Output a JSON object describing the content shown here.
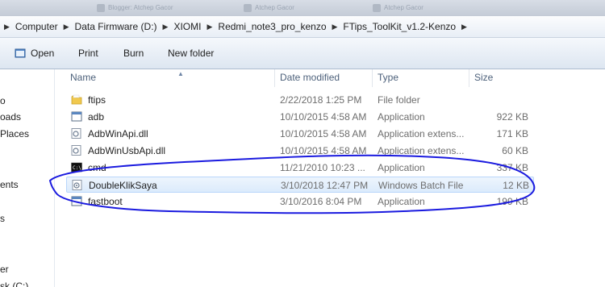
{
  "address_bar": {
    "breadcrumbs": [
      "Computer",
      "Data Firmware (D:)",
      "XIOMI",
      "Redmi_note3_pro_kenzo",
      "FTips_ToolKit_v1.2-Kenzo"
    ]
  },
  "background_tabs": [
    "Blogger: Atchep Gacor",
    "Atchep Gacor",
    "Atchep Gacor"
  ],
  "toolbar": {
    "open_label": "Open",
    "print_label": "Print",
    "burn_label": "Burn",
    "new_folder_label": "New folder"
  },
  "nav_pane": {
    "items": [
      "o",
      "oads",
      "Places",
      "ents",
      "s",
      "er",
      "sk (C:)"
    ]
  },
  "columns": {
    "name": "Name",
    "date_modified": "Date modified",
    "type": "Type",
    "size": "Size"
  },
  "files": [
    {
      "name": "ftips",
      "date": "2/22/2018 1:25 PM",
      "type": "File folder",
      "size": "",
      "icon": "folder-icon"
    },
    {
      "name": "adb",
      "date": "10/10/2015 4:58 AM",
      "type": "Application",
      "size": "922 KB",
      "icon": "application-icon"
    },
    {
      "name": "AdbWinApi.dll",
      "date": "10/10/2015 4:58 AM",
      "type": "Application extens...",
      "size": "171 KB",
      "icon": "dll-icon"
    },
    {
      "name": "AdbWinUsbApi.dll",
      "date": "10/10/2015 4:58 AM",
      "type": "Application extens...",
      "size": "60 KB",
      "icon": "dll-icon"
    },
    {
      "name": "cmd",
      "date": "11/21/2010 10:23 ...",
      "type": "Application",
      "size": "337 KB",
      "icon": "cmd-icon"
    },
    {
      "name": "DoubleKlikSaya",
      "date": "3/10/2018 12:47 PM",
      "type": "Windows Batch File",
      "size": "12 KB",
      "icon": "batch-file-icon",
      "selected": true
    },
    {
      "name": "fastboot",
      "date": "3/10/2016 8:04 PM",
      "type": "Application",
      "size": "199 KB",
      "icon": "application-icon"
    }
  ],
  "colors": {
    "annotation_ink": "#1a1adf",
    "selection_bg": "#dcebfc",
    "header_text": "#4c607a"
  }
}
